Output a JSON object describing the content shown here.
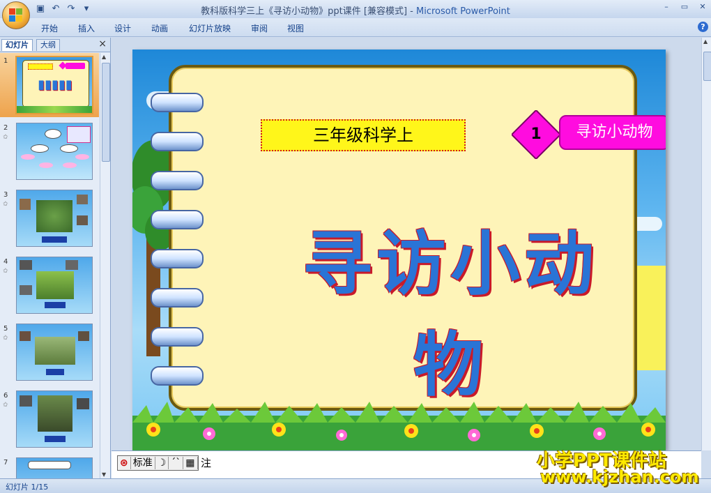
{
  "window": {
    "title_doc": "教科版科学三上《寻访小动物》ppt课件 [兼容模式] - ",
    "title_app": "Microsoft PowerPoint",
    "controls": [
      "–",
      "▭",
      "✕"
    ]
  },
  "ribbon": {
    "tabs": [
      "开始",
      "插入",
      "设计",
      "动画",
      "幻灯片放映",
      "审阅",
      "视图"
    ]
  },
  "left_pane": {
    "tab_slides": "幻灯片",
    "tab_outline": "大纲",
    "close": "×",
    "slides": [
      {
        "num": "1"
      },
      {
        "num": "2"
      },
      {
        "num": "3"
      },
      {
        "num": "4"
      },
      {
        "num": "5"
      },
      {
        "num": "6"
      },
      {
        "num": "7"
      }
    ]
  },
  "slide": {
    "grade_label": "三年级科学上",
    "lesson_number": "1",
    "lesson_title": "寻访小动物",
    "big_title": "寻访小动物"
  },
  "notes": {
    "ime_labels": [
      "标准"
    ],
    "hint_tail": "注"
  },
  "watermark": {
    "line1": "小学PPT课件站",
    "line2": "www.kjzhan.com"
  },
  "status": {
    "slide_counter": "幻灯片 1/15"
  },
  "colors": {
    "accent": "#15428b",
    "slide_tag_bg": "#fff61a",
    "lesson_title_bg": "#ff0cdf",
    "diamond": "#ff0cdf",
    "title_text": "#2a74d6"
  }
}
